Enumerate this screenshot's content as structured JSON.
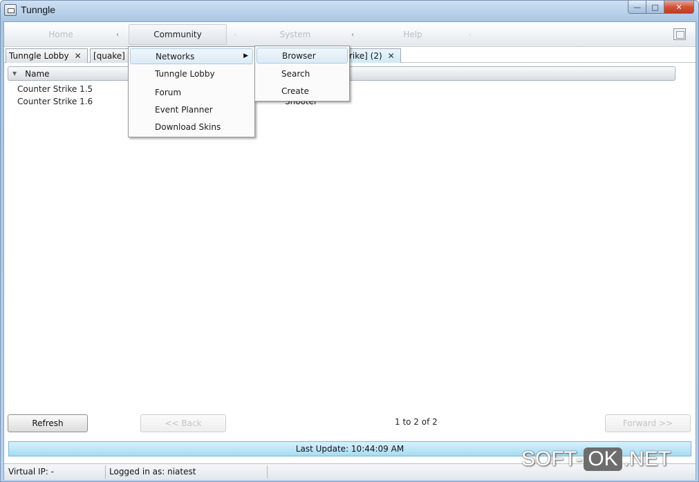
{
  "window": {
    "title": "Tunngle",
    "minimize_glyph": "—",
    "maximize_glyph": "□",
    "close_glyph": "✕"
  },
  "menubar": {
    "items": [
      {
        "label": "Home",
        "active": false
      },
      {
        "label": "Community",
        "active": true
      },
      {
        "label": "System",
        "active": false
      },
      {
        "label": "Help",
        "active": false
      }
    ],
    "arrow_glyph": "‹",
    "right_icon": "window-layout-icon"
  },
  "tabs": [
    {
      "label": "Tunngle Lobby",
      "close": "✕"
    },
    {
      "label": "[quake]",
      "close": ""
    },
    {
      "label": "rike] (2)",
      "close": "✕"
    }
  ],
  "list": {
    "sort_glyph": "▼",
    "column_name": "Name",
    "rows": [
      {
        "name": "Counter Strike 1.5",
        "genre": ""
      },
      {
        "name": "Counter Strike 1.6",
        "genre": "Shooter"
      }
    ]
  },
  "community_menu": {
    "items": [
      "Networks",
      "Tunngle Lobby",
      "Forum",
      "Event Planner",
      "Download Skins"
    ],
    "submenu_arrow": "▶"
  },
  "networks_submenu": {
    "items": [
      "Browser",
      "Search",
      "Create"
    ]
  },
  "controls": {
    "refresh": "Refresh",
    "back": "<< Back",
    "forward": "Forward >>",
    "paging": "1 to 2 of 2"
  },
  "status": {
    "last_update": "Last Update: 10:44:09 AM",
    "virtual_ip": "Virtual IP: -",
    "logged_in": "Logged in as: niatest"
  },
  "watermark": {
    "left": "SOFT-",
    "middle": "OK",
    "right": ".NET"
  }
}
